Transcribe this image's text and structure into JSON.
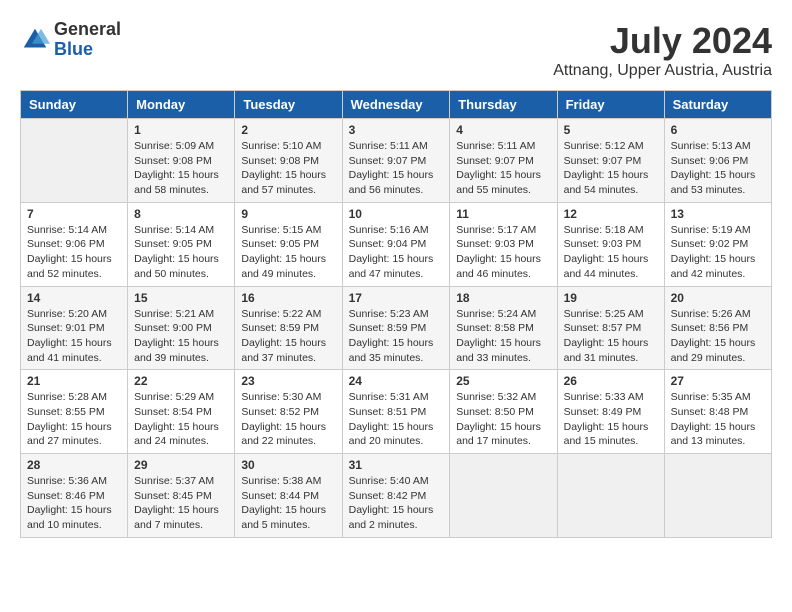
{
  "logo": {
    "general": "General",
    "blue": "Blue"
  },
  "title": "July 2024",
  "location": "Attnang, Upper Austria, Austria",
  "headers": [
    "Sunday",
    "Monday",
    "Tuesday",
    "Wednesday",
    "Thursday",
    "Friday",
    "Saturday"
  ],
  "weeks": [
    [
      {
        "day": "",
        "info": ""
      },
      {
        "day": "1",
        "info": "Sunrise: 5:09 AM\nSunset: 9:08 PM\nDaylight: 15 hours\nand 58 minutes."
      },
      {
        "day": "2",
        "info": "Sunrise: 5:10 AM\nSunset: 9:08 PM\nDaylight: 15 hours\nand 57 minutes."
      },
      {
        "day": "3",
        "info": "Sunrise: 5:11 AM\nSunset: 9:07 PM\nDaylight: 15 hours\nand 56 minutes."
      },
      {
        "day": "4",
        "info": "Sunrise: 5:11 AM\nSunset: 9:07 PM\nDaylight: 15 hours\nand 55 minutes."
      },
      {
        "day": "5",
        "info": "Sunrise: 5:12 AM\nSunset: 9:07 PM\nDaylight: 15 hours\nand 54 minutes."
      },
      {
        "day": "6",
        "info": "Sunrise: 5:13 AM\nSunset: 9:06 PM\nDaylight: 15 hours\nand 53 minutes."
      }
    ],
    [
      {
        "day": "7",
        "info": "Sunrise: 5:14 AM\nSunset: 9:06 PM\nDaylight: 15 hours\nand 52 minutes."
      },
      {
        "day": "8",
        "info": "Sunrise: 5:14 AM\nSunset: 9:05 PM\nDaylight: 15 hours\nand 50 minutes."
      },
      {
        "day": "9",
        "info": "Sunrise: 5:15 AM\nSunset: 9:05 PM\nDaylight: 15 hours\nand 49 minutes."
      },
      {
        "day": "10",
        "info": "Sunrise: 5:16 AM\nSunset: 9:04 PM\nDaylight: 15 hours\nand 47 minutes."
      },
      {
        "day": "11",
        "info": "Sunrise: 5:17 AM\nSunset: 9:03 PM\nDaylight: 15 hours\nand 46 minutes."
      },
      {
        "day": "12",
        "info": "Sunrise: 5:18 AM\nSunset: 9:03 PM\nDaylight: 15 hours\nand 44 minutes."
      },
      {
        "day": "13",
        "info": "Sunrise: 5:19 AM\nSunset: 9:02 PM\nDaylight: 15 hours\nand 42 minutes."
      }
    ],
    [
      {
        "day": "14",
        "info": "Sunrise: 5:20 AM\nSunset: 9:01 PM\nDaylight: 15 hours\nand 41 minutes."
      },
      {
        "day": "15",
        "info": "Sunrise: 5:21 AM\nSunset: 9:00 PM\nDaylight: 15 hours\nand 39 minutes."
      },
      {
        "day": "16",
        "info": "Sunrise: 5:22 AM\nSunset: 8:59 PM\nDaylight: 15 hours\nand 37 minutes."
      },
      {
        "day": "17",
        "info": "Sunrise: 5:23 AM\nSunset: 8:59 PM\nDaylight: 15 hours\nand 35 minutes."
      },
      {
        "day": "18",
        "info": "Sunrise: 5:24 AM\nSunset: 8:58 PM\nDaylight: 15 hours\nand 33 minutes."
      },
      {
        "day": "19",
        "info": "Sunrise: 5:25 AM\nSunset: 8:57 PM\nDaylight: 15 hours\nand 31 minutes."
      },
      {
        "day": "20",
        "info": "Sunrise: 5:26 AM\nSunset: 8:56 PM\nDaylight: 15 hours\nand 29 minutes."
      }
    ],
    [
      {
        "day": "21",
        "info": "Sunrise: 5:28 AM\nSunset: 8:55 PM\nDaylight: 15 hours\nand 27 minutes."
      },
      {
        "day": "22",
        "info": "Sunrise: 5:29 AM\nSunset: 8:54 PM\nDaylight: 15 hours\nand 24 minutes."
      },
      {
        "day": "23",
        "info": "Sunrise: 5:30 AM\nSunset: 8:52 PM\nDaylight: 15 hours\nand 22 minutes."
      },
      {
        "day": "24",
        "info": "Sunrise: 5:31 AM\nSunset: 8:51 PM\nDaylight: 15 hours\nand 20 minutes."
      },
      {
        "day": "25",
        "info": "Sunrise: 5:32 AM\nSunset: 8:50 PM\nDaylight: 15 hours\nand 17 minutes."
      },
      {
        "day": "26",
        "info": "Sunrise: 5:33 AM\nSunset: 8:49 PM\nDaylight: 15 hours\nand 15 minutes."
      },
      {
        "day": "27",
        "info": "Sunrise: 5:35 AM\nSunset: 8:48 PM\nDaylight: 15 hours\nand 13 minutes."
      }
    ],
    [
      {
        "day": "28",
        "info": "Sunrise: 5:36 AM\nSunset: 8:46 PM\nDaylight: 15 hours\nand 10 minutes."
      },
      {
        "day": "29",
        "info": "Sunrise: 5:37 AM\nSunset: 8:45 PM\nDaylight: 15 hours\nand 7 minutes."
      },
      {
        "day": "30",
        "info": "Sunrise: 5:38 AM\nSunset: 8:44 PM\nDaylight: 15 hours\nand 5 minutes."
      },
      {
        "day": "31",
        "info": "Sunrise: 5:40 AM\nSunset: 8:42 PM\nDaylight: 15 hours\nand 2 minutes."
      },
      {
        "day": "",
        "info": ""
      },
      {
        "day": "",
        "info": ""
      },
      {
        "day": "",
        "info": ""
      }
    ]
  ]
}
